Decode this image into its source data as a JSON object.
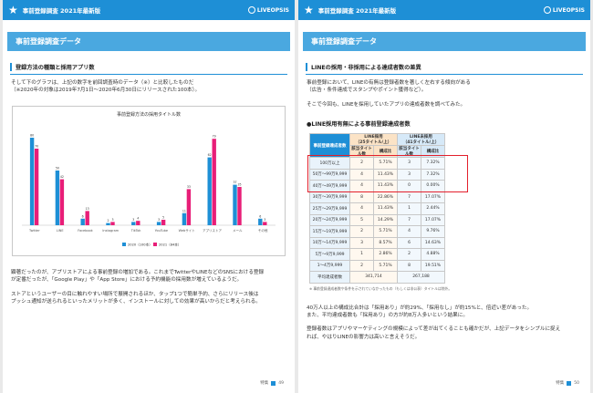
{
  "left": {
    "header_title": "事前登録調査 2021年最新版",
    "logo_text": "LIVEOPSIS",
    "band_title": "事前登録調査データ",
    "section_title": "登録方法の種類と採用アプリ数",
    "para1_line1": "そして下のグラフは、上記の数字を前回調査時のデータ（※）と比較したものだ",
    "para1_line2": "（※2020年の対象は2019年7月1日〜2020年6月30日にリリースされた100本）。",
    "para2_line1": "顕著だったのが、アプリストアによる事前登録の増加である。これまでTwitterやLINEなどのSNSにおける登録",
    "para2_line2": "が定番だったが、「Google Play」や「App Store」における予約機能の採用数が増えているようだ。",
    "para3_line1": "ストアというユーザーの目に触れやすい場所で展開されるほか、タップ1つで簡単予約、さらにリリース後は",
    "para3_line2": "プッシュ通知が送られるといったメリットが多く、インストールに対しての効果が高いからだと考えられる。",
    "footer_label": "特集",
    "page_number": "49"
  },
  "right": {
    "header_title": "事前登録調査 2021年最新版",
    "logo_text": "LIVEOPSIS",
    "band_title": "事前登録調査データ",
    "section_title": "LINEの採用・非採用による達成者数の差異",
    "para1_line1": "事前登録において、LINEの有無は登録者数を著しく左右する傾向がある",
    "para1_line2": "（広告・条件達成でスタンプやポイント獲得など）。",
    "para2": "そこで今回も、LINEを採用していたアプリの達成者数を調べてみた。",
    "table_title": "●LINE採用有無による事前登録達成者数",
    "table": {
      "corner": "事前登録達成者数",
      "group1": "LINE採用",
      "group1_sub": "（25タイトル/上）",
      "group2": "LINE未採用",
      "group2_sub": "（41タイトル/上）",
      "col_count": "該当タイトル数",
      "col_ratio": "構成比",
      "rows": [
        {
          "label": "100万以上",
          "c1": "2",
          "r1": "5.71%",
          "c2": "3",
          "r2": "7.32%"
        },
        {
          "label": "50万〜99万9,999",
          "c1": "4",
          "r1": "11.43%",
          "c2": "3",
          "r2": "7.32%"
        },
        {
          "label": "40万〜49万9,999",
          "c1": "4",
          "r1": "11.43%",
          "c2": "0",
          "r2": "0.00%"
        },
        {
          "label": "30万〜39万9,999",
          "c1": "8",
          "r1": "22.86%",
          "c2": "7",
          "r2": "17.07%"
        },
        {
          "label": "25万〜29万9,999",
          "c1": "4",
          "r1": "11.43%",
          "c2": "1",
          "r2": "2.44%"
        },
        {
          "label": "20万〜24万9,999",
          "c1": "5",
          "r1": "14.29%",
          "c2": "7",
          "r2": "17.07%"
        },
        {
          "label": "15万〜19万9,999",
          "c1": "2",
          "r1": "5.71%",
          "c2": "4",
          "r2": "9.76%"
        },
        {
          "label": "10万〜14万9,999",
          "c1": "3",
          "r1": "8.57%",
          "c2": "6",
          "r2": "14.63%"
        },
        {
          "label": "5万〜9万9,999",
          "c1": "1",
          "r1": "2.86%",
          "c2": "2",
          "r2": "4.88%"
        },
        {
          "label": "1〜4万9,999",
          "c1": "2",
          "r1": "5.71%",
          "c2": "8",
          "r2": "19.51%"
        },
        {
          "label": "平均達成者数",
          "c1": "341,714",
          "r1": "",
          "c2": "267,188",
          "r2": ""
        }
      ]
    },
    "table_note": "※ 事前登録達成者数や条件を示されていなかったもの（もしくは非公表）タイトルは除外。",
    "para3_line1": "40万人以上の構成比合計は「採用あり」が約29%、「採用なし」が約15%と、倍近い差があった。",
    "para3_line2": "また、平均達成者数も「採用あり」の方が約8万人多いという結果に。",
    "para4_line1": "登録者数はアプリやマーケティングの規模によって差が出てくることも確かだが、上記データをシンプルに捉え",
    "para4_line2": "れば、やはりLINEの影響力は高いと言えそうだ。",
    "footer_label": "特集",
    "page_number": "50"
  },
  "chart_data": {
    "type": "bar",
    "title": "事前登録方法の採用タイトル数",
    "categories": [
      "Twitter",
      "LINE",
      "Facebook",
      "Instagram",
      "TikTok",
      "YouTube",
      "Webサイト",
      "アプリストア",
      "メール",
      "その他"
    ],
    "series": [
      {
        "name": "2020（100本）",
        "values": [
          80,
          50,
          6,
          2,
          3,
          3,
          11,
          62,
          37,
          6
        ],
        "color": "#1e8fd6"
      },
      {
        "name": "2021（84本）",
        "values": [
          70,
          42,
          13,
          3,
          4,
          5,
          33,
          79,
          35,
          3
        ],
        "color": "#e81e78"
      }
    ],
    "ylim": [
      0,
      90
    ],
    "legend": "bottom-center",
    "grid": false
  },
  "colors": {
    "brand_blue": "#1e8fd6",
    "band_blue": "#4aa8e0",
    "highlight_red": "#e3202c"
  }
}
